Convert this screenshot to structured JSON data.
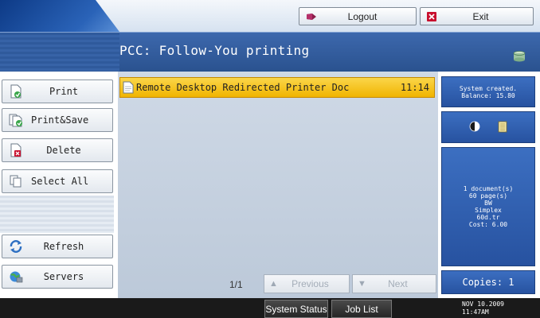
{
  "header": {
    "logout_label": "Logout",
    "exit_label": "Exit",
    "title": "PCC: Follow-You printing"
  },
  "sidebar": {
    "print_label": "Print",
    "print_save_label": "Print&Save",
    "delete_label": "Delete",
    "select_all_label": "Select All",
    "refresh_label": "Refresh",
    "servers_label": "Servers"
  },
  "job_list": {
    "jobs": [
      {
        "name": "Remote Desktop Redirected Printer Doc",
        "time": "11:14",
        "selected": true
      }
    ]
  },
  "pager": {
    "page_indicator": "1/1",
    "previous_label": "Previous",
    "next_label": "Next"
  },
  "info": {
    "system_line1": "System created.",
    "system_line2": "Balance: 15.80",
    "documents": "1 document(s)",
    "pages": "60 page(s)",
    "color_mode": "BW",
    "duplex": "Simplex",
    "paper": "60d.tr",
    "cost": "Cost: 6.00",
    "copies": "Copies: 1"
  },
  "statusbar": {
    "system_status_label": "System Status",
    "job_list_label": "Job List",
    "date": "NOV  10.2009",
    "time": "11:47AM"
  },
  "colors": {
    "title_bar": "#2f5a9c",
    "info_panel": "#2f5fb0",
    "selected_row": "#f5c518"
  }
}
